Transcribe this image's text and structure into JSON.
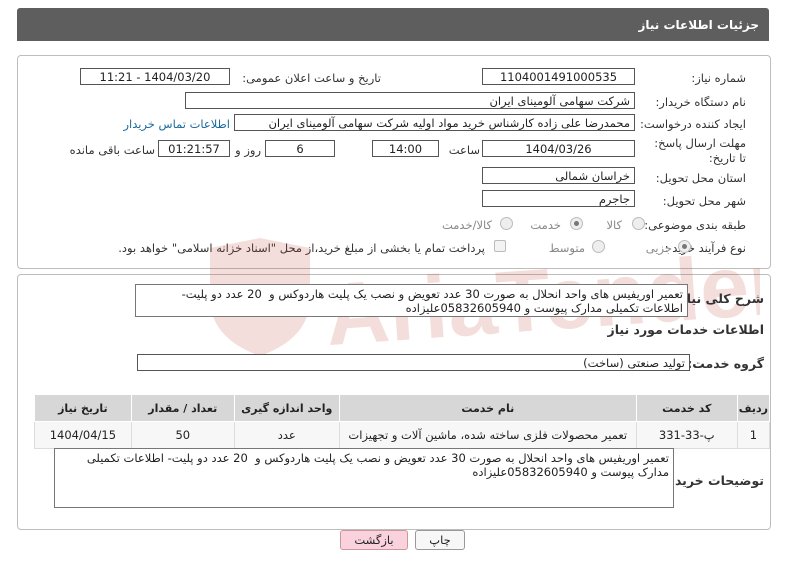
{
  "header": {
    "title": "جزئیات اطلاعات نیاز"
  },
  "form": {
    "need_number_label": "شماره نیاز:",
    "need_number": "1104001491000535",
    "announce_label": "تاریخ و ساعت اعلان عمومی:",
    "announce_value": "1404/03/20 - 11:21",
    "buyer_label": "نام دستگاه خریدار:",
    "buyer_value": "شرکت سهامی آلومینای ایران",
    "creator_label": "ایجاد کننده درخواست:",
    "creator_value": "محمدرضا علی زاده کارشناس خرید مواد اولیه شرکت سهامی آلومینای ایران",
    "contact_link": "اطلاعات تماس خریدار",
    "deadline_label": "مهلت ارسال پاسخ: تا تاریخ:",
    "deadline_date": "1404/03/26",
    "time_label": "ساعت",
    "deadline_time": "14:00",
    "days_value": "6",
    "days_label": "روز و",
    "remaining_time": "01:21:57",
    "remaining_label": "ساعت باقی مانده",
    "province_label": "استان محل تحویل:",
    "province_value": "خراسان شمالی",
    "city_label": "شهر محل تحویل:",
    "city_value": "جاجرم",
    "category_label": "طبقه بندی موضوعی:",
    "category_options": [
      "کالا",
      "خدمت",
      "کالا/خدمت"
    ],
    "process_label": "نوع فرآیند خرید :",
    "process_options": [
      "جزیی",
      "متوسط"
    ],
    "payment_text": "پرداخت تمام یا بخشی از مبلغ خرید،از محل \"اسناد خزانه اسلامی\" خواهد بود."
  },
  "summary": {
    "label": "شرح کلی نیاز:",
    "text": "تعمیر اوریفیس های واحد انحلال به صورت 30 عدد تعویض و نصب یک پلیت هاردوکس و  20 عدد دو پلیت- اطلاعات تکمیلی مدارک پیوست و 05832605940علیزاده"
  },
  "services": {
    "section_title": "اطلاعات خدمات مورد نیاز",
    "group_label": "گروه خدمت:",
    "group_value": "تولید صنعتی (ساخت)",
    "columns": [
      "ردیف",
      "کد خدمت",
      "نام خدمت",
      "واحد اندازه گیری",
      "تعداد / مقدار",
      "تاریخ نیاز"
    ],
    "rows": [
      [
        "1",
        "پ-33-331",
        "تعمیر محصولات فلزی ساخته شده، ماشین آلات و تجهیزات",
        "عدد",
        "50",
        "1404/04/15"
      ]
    ]
  },
  "buyer_notes": {
    "label": "توضیحات خریدار:",
    "text": "تعمیر اوریفیس های واحد انحلال به صورت 30 عدد تعویض و نصب یک پلیت هاردوکس و  20 عدد دو پلیت- اطلاعات تکمیلی مدارک پیوست و 05832605940علیزاده"
  },
  "buttons": {
    "print": "چاپ",
    "back": "بازگشت"
  },
  "watermark": {
    "text": "AriaTender.net"
  }
}
